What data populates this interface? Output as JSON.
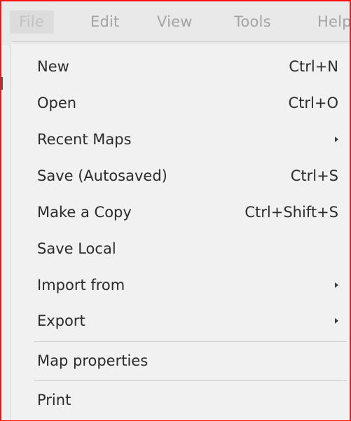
{
  "menubar": {
    "items": [
      "File",
      "Edit",
      "View",
      "Tools",
      "Help"
    ]
  },
  "file_menu": {
    "items": [
      {
        "label": "New",
        "shortcut": "Ctrl+N",
        "submenu": false
      },
      {
        "label": "Open",
        "shortcut": "Ctrl+O",
        "submenu": false
      },
      {
        "label": "Recent Maps",
        "shortcut": "",
        "submenu": true
      },
      {
        "label": "Save (Autosaved)",
        "shortcut": "Ctrl+S",
        "submenu": false
      },
      {
        "label": "Make a Copy",
        "shortcut": "Ctrl+Shift+S",
        "submenu": false
      },
      {
        "label": "Save Local",
        "shortcut": "",
        "submenu": false
      },
      {
        "label": "Import from",
        "shortcut": "",
        "submenu": true
      },
      {
        "label": "Export",
        "shortcut": "",
        "submenu": true
      },
      {
        "label": "Map properties",
        "shortcut": "",
        "submenu": false
      },
      {
        "label": "Print",
        "shortcut": "",
        "submenu": false
      }
    ]
  },
  "colors": {
    "frame_border": "#ff1010",
    "outer_background": "#0a2fc7",
    "menu_background": "#f1f1f1",
    "menubar_background": "#e9e9e9",
    "text": "#2b2b2b",
    "menubar_text": "#a4a4a4"
  },
  "icons": {
    "submenu_indicator": "submenu-arrow-icon"
  }
}
